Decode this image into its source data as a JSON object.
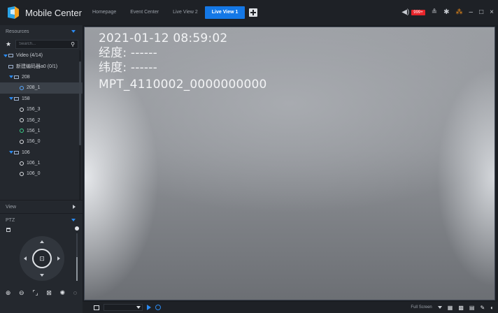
{
  "app": {
    "title": "Mobile Center"
  },
  "tabs": [
    {
      "label": "Homepage",
      "active": false
    },
    {
      "label": "Event Center",
      "active": false
    },
    {
      "label": "Live View 2",
      "active": false
    },
    {
      "label": "Live View 1",
      "active": true
    }
  ],
  "titlebar": {
    "alarm_count": "999+"
  },
  "sidebar": {
    "resources_label": "Resources",
    "search_placeholder": "Search...",
    "tree": [
      {
        "label": "Video (4/14)"
      },
      {
        "label": "新建编码器a0 (0/1)"
      },
      {
        "label": "208"
      },
      {
        "label": "208_1"
      },
      {
        "label": "158"
      },
      {
        "label": "156_3"
      },
      {
        "label": "156_2"
      },
      {
        "label": "156_1"
      },
      {
        "label": "156_0"
      },
      {
        "label": "106"
      },
      {
        "label": "106_1"
      },
      {
        "label": "106_0"
      }
    ],
    "view_label": "View",
    "ptz_label": "PTZ"
  },
  "video": {
    "osd_datetime": "2021-01-12  08:59:02",
    "osd_longitude": "经度: ------",
    "osd_latitude": "纬度: ------",
    "osd_device": "MPT_4110002_0000000000"
  },
  "bottombar": {
    "fullscreen_label": "Full Screen"
  },
  "colors": {
    "accent": "#1478e6",
    "alarm": "#e8242a",
    "online": "#3bd08a"
  }
}
